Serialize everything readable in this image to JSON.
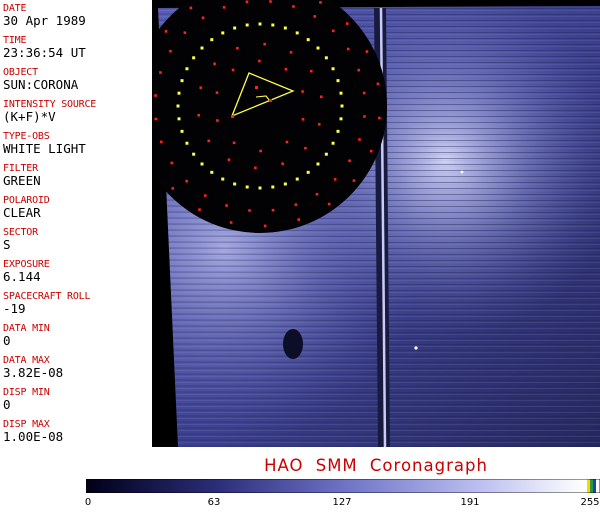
{
  "fields": [
    {
      "label": "DATE",
      "value": "30 Apr 1989"
    },
    {
      "label": "TIME",
      "value": "23:36:54 UT"
    },
    {
      "label": "OBJECT",
      "value": "SUN:CORONA"
    },
    {
      "label": "INTENSITY SOURCE",
      "value": "(K+F)*V"
    },
    {
      "label": "TYPE-OBS",
      "value": "WHITE LIGHT"
    },
    {
      "label": "FILTER",
      "value": "GREEN"
    },
    {
      "label": "POLAROID",
      "value": "CLEAR"
    },
    {
      "label": "SECTOR",
      "value": "S"
    },
    {
      "label": "EXPOSURE",
      "value": "6.144"
    },
    {
      "label": "SPACECRAFT ROLL",
      "value": "-19"
    },
    {
      "label": "DATA MIN",
      "value": "0"
    },
    {
      "label": "DATA MAX",
      "value": "3.82E-08"
    },
    {
      "label": "DISP MIN",
      "value": "0"
    },
    {
      "label": "DISP MAX",
      "value": "1.00E-08"
    }
  ],
  "caption": "HAO  SMM Coronagraph",
  "colorbar": {
    "ticks": [
      "0",
      "63",
      "127",
      "191",
      "255"
    ],
    "min_color": "#000018",
    "max_color": "#ffffff"
  },
  "colors": {
    "label": "#cc0000",
    "occulter_dots": "#ffff44",
    "grid_marks": "#ff2020",
    "corona": "#4a4fa8"
  }
}
